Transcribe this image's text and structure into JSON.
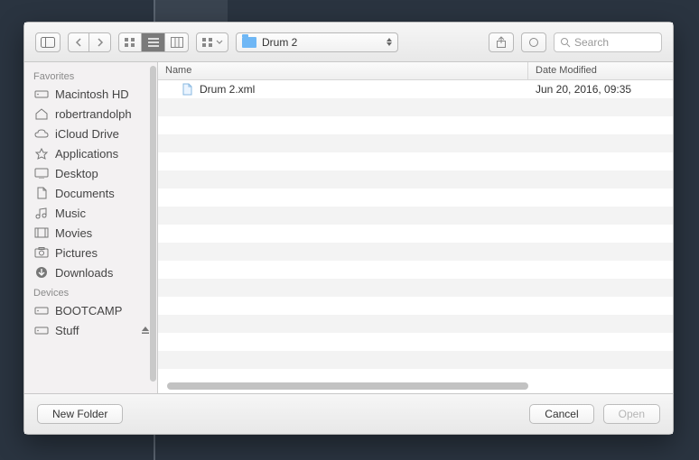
{
  "path": {
    "label": "Drum 2"
  },
  "search": {
    "placeholder": "Search"
  },
  "columns": {
    "name": "Name",
    "date": "Date Modified"
  },
  "files": [
    {
      "name": "Drum 2.xml",
      "date": "Jun 20, 2016, 09:35"
    }
  ],
  "sidebar": {
    "sections": [
      {
        "title": "Favorites",
        "items": [
          {
            "label": "Macintosh HD",
            "icon": "hdd"
          },
          {
            "label": "robertrandolph",
            "icon": "home"
          },
          {
            "label": "iCloud Drive",
            "icon": "cloud"
          },
          {
            "label": "Applications",
            "icon": "apps"
          },
          {
            "label": "Desktop",
            "icon": "desktop"
          },
          {
            "label": "Documents",
            "icon": "docs"
          },
          {
            "label": "Music",
            "icon": "music"
          },
          {
            "label": "Movies",
            "icon": "movies"
          },
          {
            "label": "Pictures",
            "icon": "pictures"
          },
          {
            "label": "Downloads",
            "icon": "downloads"
          }
        ]
      },
      {
        "title": "Devices",
        "items": [
          {
            "label": "BOOTCAMP",
            "icon": "hdd"
          },
          {
            "label": "Stuff",
            "icon": "hdd",
            "eject": true
          }
        ]
      }
    ]
  },
  "footer": {
    "newfolder": "New Folder",
    "cancel": "Cancel",
    "open": "Open"
  }
}
